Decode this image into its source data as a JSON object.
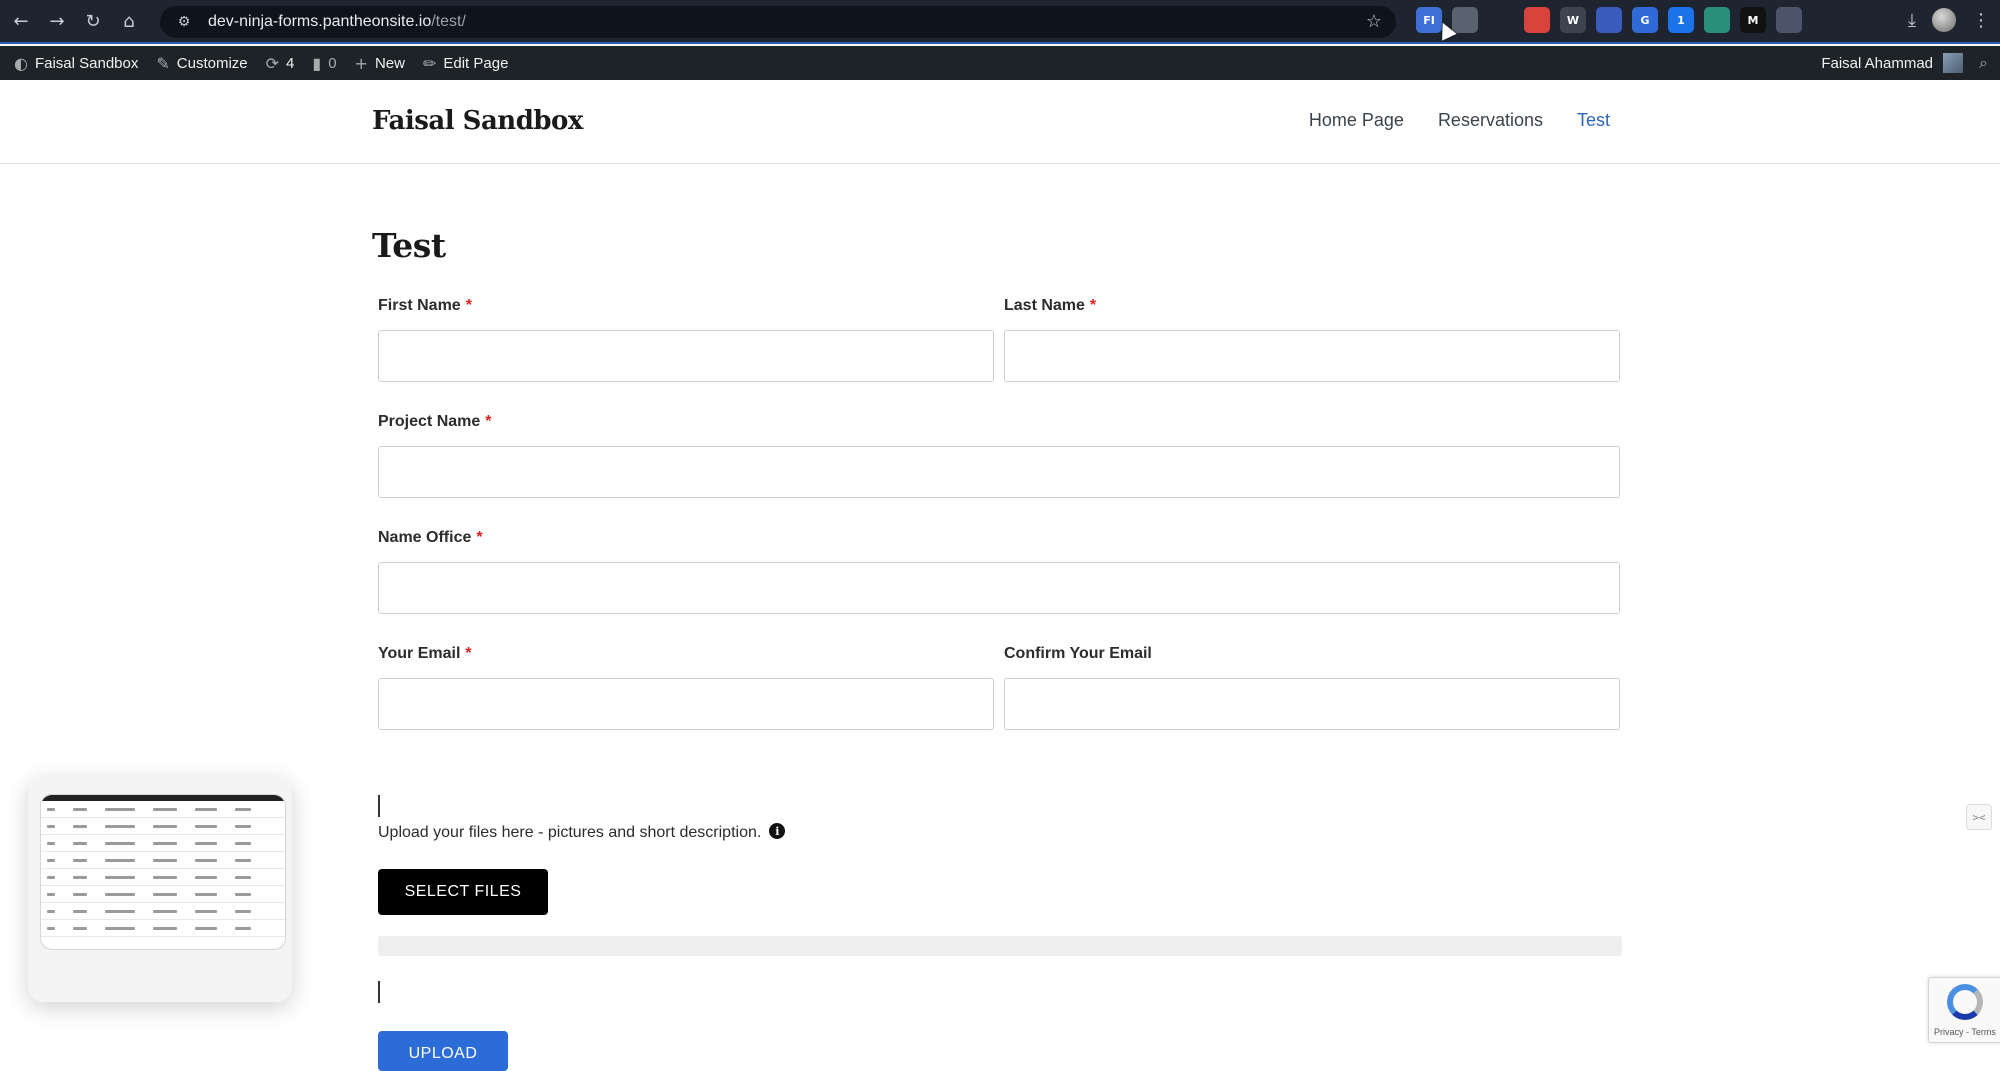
{
  "browser": {
    "url_host": "dev-ninja-forms.pantheonsite.io",
    "url_path": "/test/",
    "extensions": [
      {
        "name": "ext-fi",
        "label": "FI",
        "color": "#3d6fd6"
      },
      {
        "name": "ext-shield",
        "label": "",
        "color": "#5a6270"
      },
      {
        "name": "ext-edge",
        "label": "",
        "color": "#1f2530"
      },
      {
        "name": "ext-chrome",
        "label": "",
        "color": "#d8433b"
      },
      {
        "name": "ext-wordpress",
        "label": "W",
        "color": "#3d4450"
      },
      {
        "name": "ext-arc",
        "label": "",
        "color": "#3b5bbf"
      },
      {
        "name": "ext-translate",
        "label": "G",
        "color": "#2f6ad6"
      },
      {
        "name": "ext-1password",
        "label": "1",
        "color": "#1a73e8"
      },
      {
        "name": "ext-forward",
        "label": "",
        "color": "#2a8f7a"
      },
      {
        "name": "ext-m",
        "label": "M",
        "color": "#111111"
      },
      {
        "name": "ext-image",
        "label": "",
        "color": "#4b5468"
      },
      {
        "name": "ext-puzzle",
        "label": "",
        "color": "#1f2530"
      }
    ]
  },
  "admin_bar": {
    "site_name": "Faisal Sandbox",
    "customize": "Customize",
    "updates_count": "4",
    "comments_count": "0",
    "new_label": "New",
    "edit_page": "Edit Page",
    "user_name": "Faisal Ahammad"
  },
  "header": {
    "site_title": "Faisal Sandbox",
    "nav": [
      "Home Page",
      "Reservations",
      "Test"
    ]
  },
  "page": {
    "title": "Test"
  },
  "form": {
    "first_name_label": "First Name",
    "last_name_label": "Last Name",
    "project_name_label": "Project Name",
    "name_office_label": "Name Office",
    "your_email_label": "Your Email",
    "confirm_email_label": "Confirm Your Email",
    "required_marker": "*",
    "upload_text": "Upload your files here - pictures and short description.",
    "select_files_label": "SELECT FILES",
    "upload_label": "UPLOAD",
    "upload_progress": 0
  },
  "recaptcha": {
    "text": "Privacy - Terms"
  },
  "side_tab": {
    "label": "><"
  }
}
